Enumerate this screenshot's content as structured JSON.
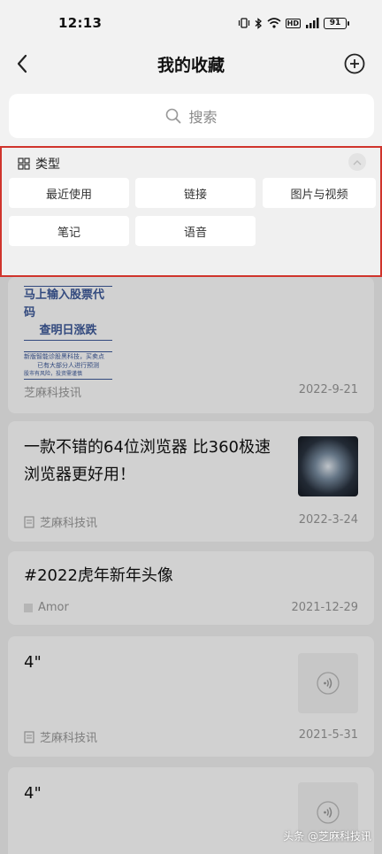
{
  "status": {
    "time": "12:13",
    "battery": "91",
    "hd": "HD"
  },
  "header": {
    "title": "我的收藏",
    "back_icon": "chevron-left-icon",
    "add_icon": "plus-circle-icon"
  },
  "search": {
    "placeholder": "搜索"
  },
  "type_panel": {
    "title": "类型",
    "chips": [
      "最近使用",
      "链接",
      "图片与视频",
      "笔记",
      "语音"
    ]
  },
  "cards": [
    {
      "ad_lines": [
        "马上输入股票代码",
        "查明日涨跌",
        "新版智能诊股黑科技，买卖点",
        "已有大部分人进行预测",
        "股市有风险，投资需谨慎"
      ],
      "source": "芝麻科技讯",
      "date": "2022-9-21"
    },
    {
      "title": "一款不错的64位浏览器 比360极速浏览器更好用！",
      "source": "芝麻科技讯",
      "date": "2022-3-24"
    },
    {
      "title": "#2022虎年新年头像",
      "source": "Amor",
      "date": "2021-12-29"
    },
    {
      "title": "4\"",
      "source": "芝麻科技讯",
      "date": "2021-5-31"
    },
    {
      "title": "4\""
    }
  ],
  "watermark": "头条 @芝麻科技讯",
  "colors": {
    "highlight_border": "#d0342c",
    "background": "#f2f2f2"
  }
}
